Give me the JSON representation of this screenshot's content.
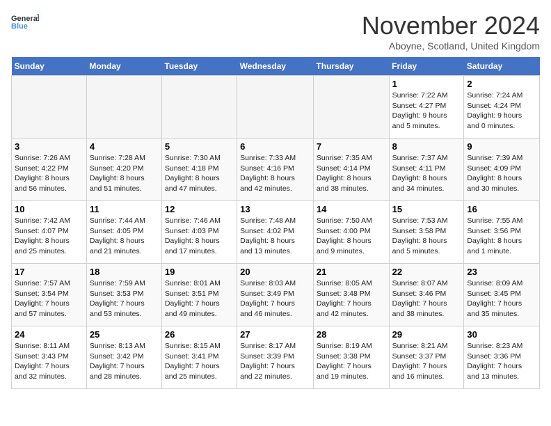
{
  "logo": {
    "line1": "General",
    "line2": "Blue"
  },
  "title": "November 2024",
  "location": "Aboyne, Scotland, United Kingdom",
  "weekdays": [
    "Sunday",
    "Monday",
    "Tuesday",
    "Wednesday",
    "Thursday",
    "Friday",
    "Saturday"
  ],
  "weeks": [
    [
      {
        "day": "",
        "info": ""
      },
      {
        "day": "",
        "info": ""
      },
      {
        "day": "",
        "info": ""
      },
      {
        "day": "",
        "info": ""
      },
      {
        "day": "",
        "info": ""
      },
      {
        "day": "1",
        "info": "Sunrise: 7:22 AM\nSunset: 4:27 PM\nDaylight: 9 hours\nand 5 minutes."
      },
      {
        "day": "2",
        "info": "Sunrise: 7:24 AM\nSunset: 4:24 PM\nDaylight: 9 hours\nand 0 minutes."
      }
    ],
    [
      {
        "day": "3",
        "info": "Sunrise: 7:26 AM\nSunset: 4:22 PM\nDaylight: 8 hours\nand 56 minutes."
      },
      {
        "day": "4",
        "info": "Sunrise: 7:28 AM\nSunset: 4:20 PM\nDaylight: 8 hours\nand 51 minutes."
      },
      {
        "day": "5",
        "info": "Sunrise: 7:30 AM\nSunset: 4:18 PM\nDaylight: 8 hours\nand 47 minutes."
      },
      {
        "day": "6",
        "info": "Sunrise: 7:33 AM\nSunset: 4:16 PM\nDaylight: 8 hours\nand 42 minutes."
      },
      {
        "day": "7",
        "info": "Sunrise: 7:35 AM\nSunset: 4:14 PM\nDaylight: 8 hours\nand 38 minutes."
      },
      {
        "day": "8",
        "info": "Sunrise: 7:37 AM\nSunset: 4:11 PM\nDaylight: 8 hours\nand 34 minutes."
      },
      {
        "day": "9",
        "info": "Sunrise: 7:39 AM\nSunset: 4:09 PM\nDaylight: 8 hours\nand 30 minutes."
      }
    ],
    [
      {
        "day": "10",
        "info": "Sunrise: 7:42 AM\nSunset: 4:07 PM\nDaylight: 8 hours\nand 25 minutes."
      },
      {
        "day": "11",
        "info": "Sunrise: 7:44 AM\nSunset: 4:05 PM\nDaylight: 8 hours\nand 21 minutes."
      },
      {
        "day": "12",
        "info": "Sunrise: 7:46 AM\nSunset: 4:03 PM\nDaylight: 8 hours\nand 17 minutes."
      },
      {
        "day": "13",
        "info": "Sunrise: 7:48 AM\nSunset: 4:02 PM\nDaylight: 8 hours\nand 13 minutes."
      },
      {
        "day": "14",
        "info": "Sunrise: 7:50 AM\nSunset: 4:00 PM\nDaylight: 8 hours\nand 9 minutes."
      },
      {
        "day": "15",
        "info": "Sunrise: 7:53 AM\nSunset: 3:58 PM\nDaylight: 8 hours\nand 5 minutes."
      },
      {
        "day": "16",
        "info": "Sunrise: 7:55 AM\nSunset: 3:56 PM\nDaylight: 8 hours\nand 1 minute."
      }
    ],
    [
      {
        "day": "17",
        "info": "Sunrise: 7:57 AM\nSunset: 3:54 PM\nDaylight: 7 hours\nand 57 minutes."
      },
      {
        "day": "18",
        "info": "Sunrise: 7:59 AM\nSunset: 3:53 PM\nDaylight: 7 hours\nand 53 minutes."
      },
      {
        "day": "19",
        "info": "Sunrise: 8:01 AM\nSunset: 3:51 PM\nDaylight: 7 hours\nand 49 minutes."
      },
      {
        "day": "20",
        "info": "Sunrise: 8:03 AM\nSunset: 3:49 PM\nDaylight: 7 hours\nand 46 minutes."
      },
      {
        "day": "21",
        "info": "Sunrise: 8:05 AM\nSunset: 3:48 PM\nDaylight: 7 hours\nand 42 minutes."
      },
      {
        "day": "22",
        "info": "Sunrise: 8:07 AM\nSunset: 3:46 PM\nDaylight: 7 hours\nand 38 minutes."
      },
      {
        "day": "23",
        "info": "Sunrise: 8:09 AM\nSunset: 3:45 PM\nDaylight: 7 hours\nand 35 minutes."
      }
    ],
    [
      {
        "day": "24",
        "info": "Sunrise: 8:11 AM\nSunset: 3:43 PM\nDaylight: 7 hours\nand 32 minutes."
      },
      {
        "day": "25",
        "info": "Sunrise: 8:13 AM\nSunset: 3:42 PM\nDaylight: 7 hours\nand 28 minutes."
      },
      {
        "day": "26",
        "info": "Sunrise: 8:15 AM\nSunset: 3:41 PM\nDaylight: 7 hours\nand 25 minutes."
      },
      {
        "day": "27",
        "info": "Sunrise: 8:17 AM\nSunset: 3:39 PM\nDaylight: 7 hours\nand 22 minutes."
      },
      {
        "day": "28",
        "info": "Sunrise: 8:19 AM\nSunset: 3:38 PM\nDaylight: 7 hours\nand 19 minutes."
      },
      {
        "day": "29",
        "info": "Sunrise: 8:21 AM\nSunset: 3:37 PM\nDaylight: 7 hours\nand 16 minutes."
      },
      {
        "day": "30",
        "info": "Sunrise: 8:23 AM\nSunset: 3:36 PM\nDaylight: 7 hours\nand 13 minutes."
      }
    ]
  ]
}
